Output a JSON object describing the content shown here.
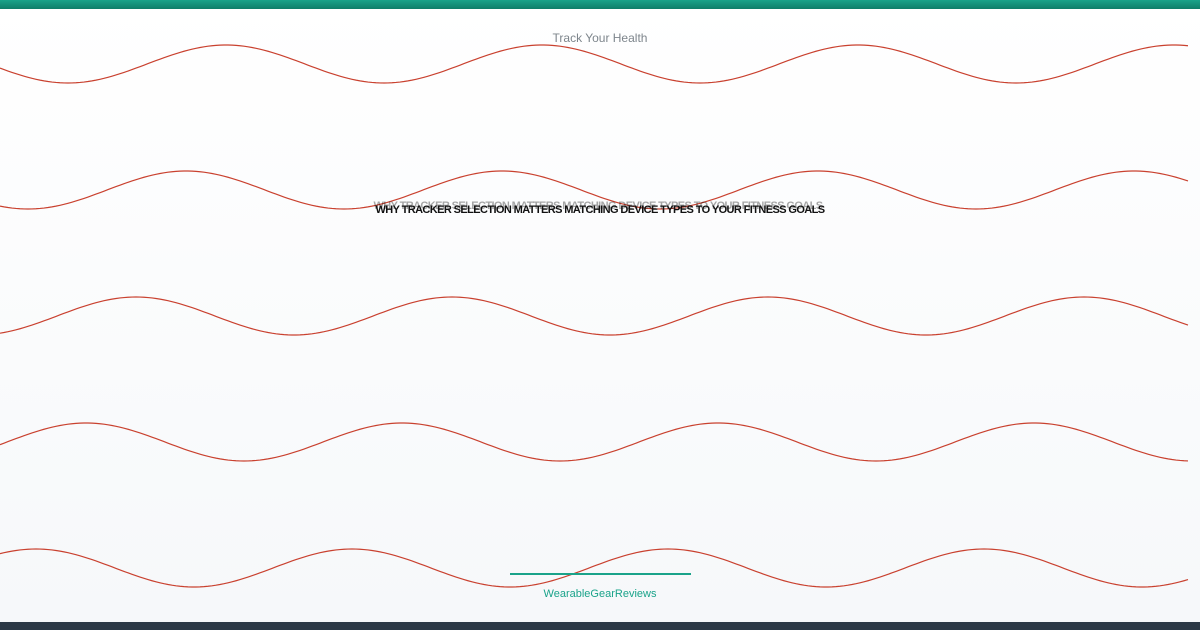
{
  "kicker": "Track Your Health",
  "title": "WHY TRACKER SELECTION MATTERS MATCHING DEVICE TYPES TO YOUR FITNESS GOALS",
  "brand": "WearableGearReviews",
  "colors": {
    "accent": "#1aa38a",
    "wave": "#c9412f",
    "footer": "#2c3946"
  }
}
